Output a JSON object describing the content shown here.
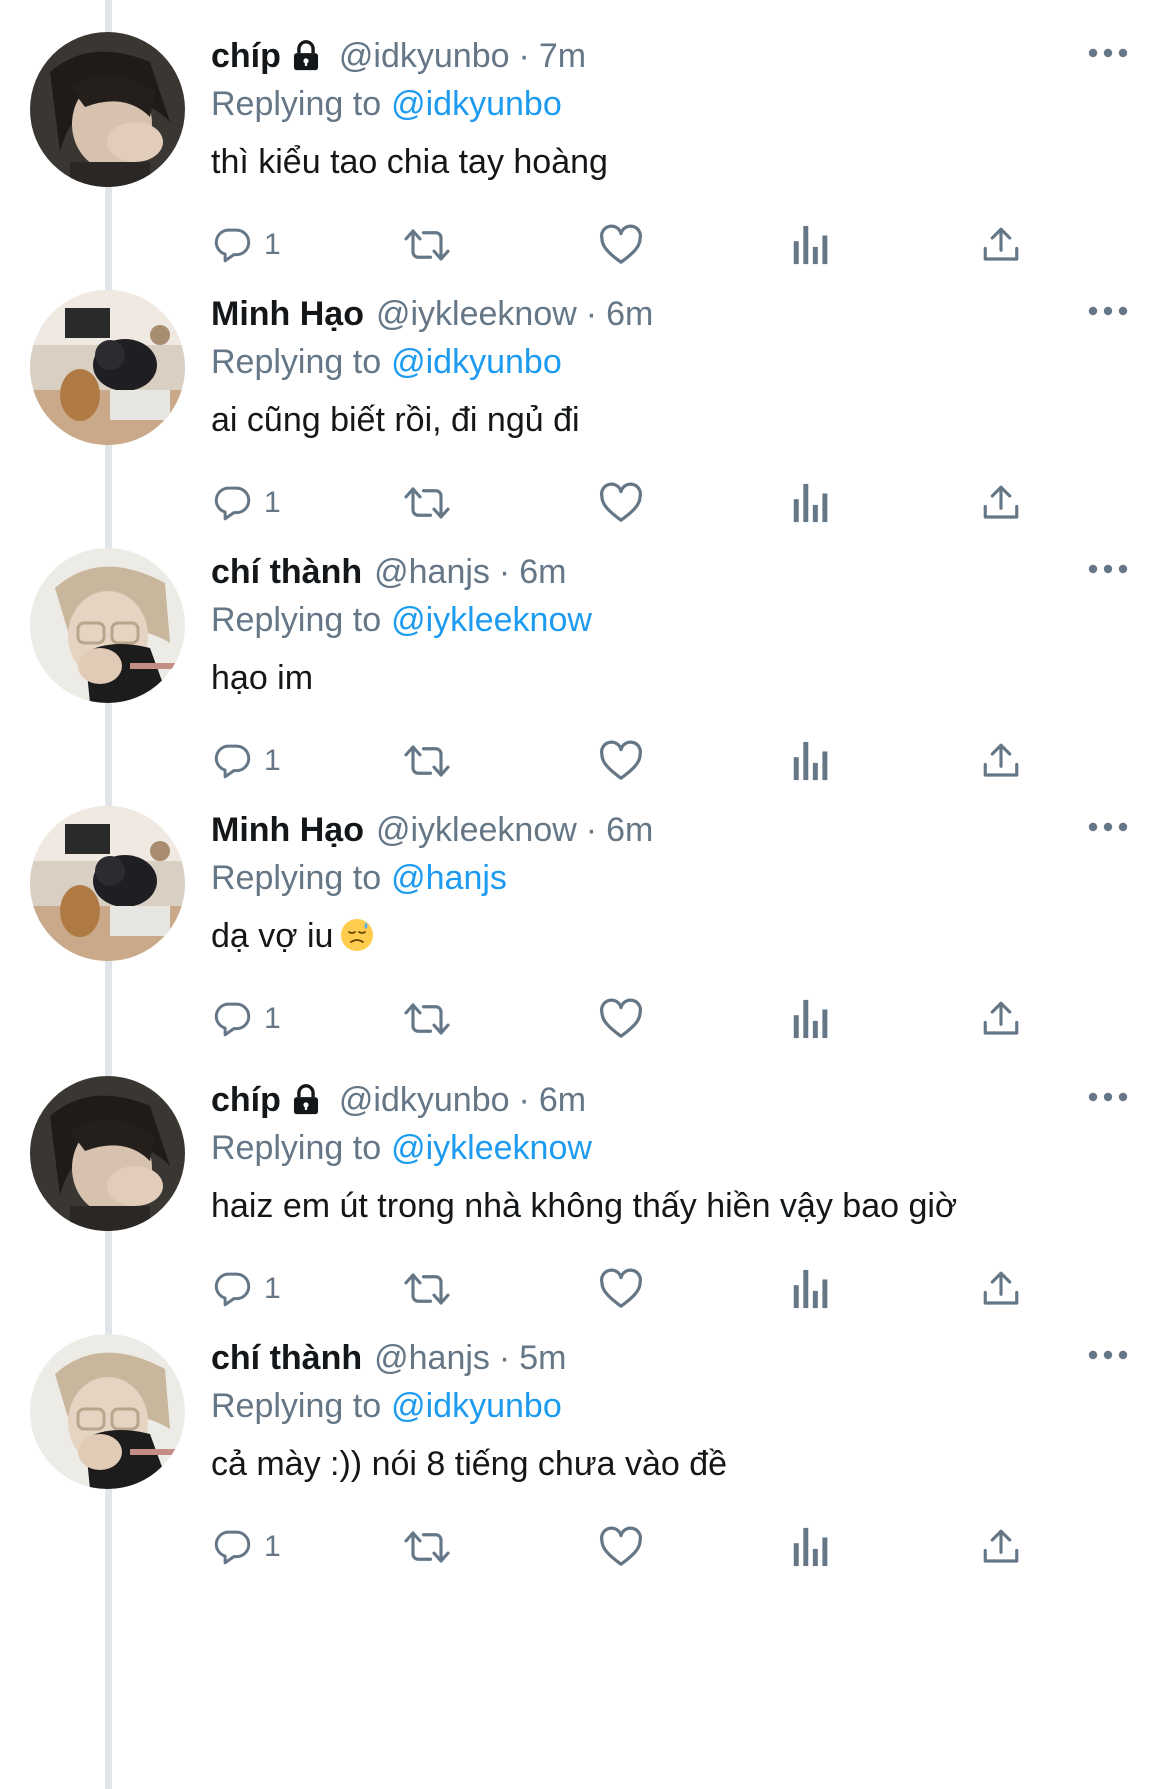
{
  "tweets": [
    {
      "name": "chíp",
      "locked": true,
      "handle": "@idkyunbo",
      "time": "7m",
      "reply_label": "Replying to",
      "reply_to": "@idkyunbo",
      "text": "thì kiểu tao chia tay hoàng",
      "reply_count": "1",
      "avatar": "chip"
    },
    {
      "name": "Minh Hạo",
      "locked": false,
      "handle": "@iykleeknow",
      "time": "6m",
      "reply_label": "Replying to",
      "reply_to": "@idkyunbo",
      "text": "ai cũng biết rồi, đi ngủ đi",
      "reply_count": "1",
      "avatar": "minhhao"
    },
    {
      "name": "chí thành",
      "locked": false,
      "handle": "@hanjs",
      "time": "6m",
      "reply_label": "Replying to",
      "reply_to": "@iykleeknow",
      "text": "hạo im",
      "reply_count": "1",
      "avatar": "chithanh"
    },
    {
      "name": "Minh Hạo",
      "locked": false,
      "handle": "@iykleeknow",
      "time": "6m",
      "reply_label": "Replying to",
      "reply_to": "@hanjs",
      "text": "dạ vợ iu",
      "emoji": "downcast-sweat-face",
      "reply_count": "1",
      "avatar": "minhhao"
    },
    {
      "name": "chíp",
      "locked": true,
      "handle": "@idkyunbo",
      "time": "6m",
      "reply_label": "Replying to",
      "reply_to": "@iykleeknow",
      "text": "haiz em út trong nhà không thấy hiền vậy bao giờ",
      "reply_count": "1",
      "avatar": "chip"
    },
    {
      "name": "chí thành",
      "locked": false,
      "handle": "@hanjs",
      "time": "5m",
      "reply_label": "Replying to",
      "reply_to": "@idkyunbo",
      "text": "cả mày :)) nói 8 tiếng chưa vào đề",
      "reply_count": "1",
      "avatar": "chithanh"
    }
  ],
  "separator": "·",
  "colors": {
    "text": "#14171a",
    "muted": "#657786",
    "link": "#1d9bf0",
    "thread_line": "#e1e5e9"
  }
}
